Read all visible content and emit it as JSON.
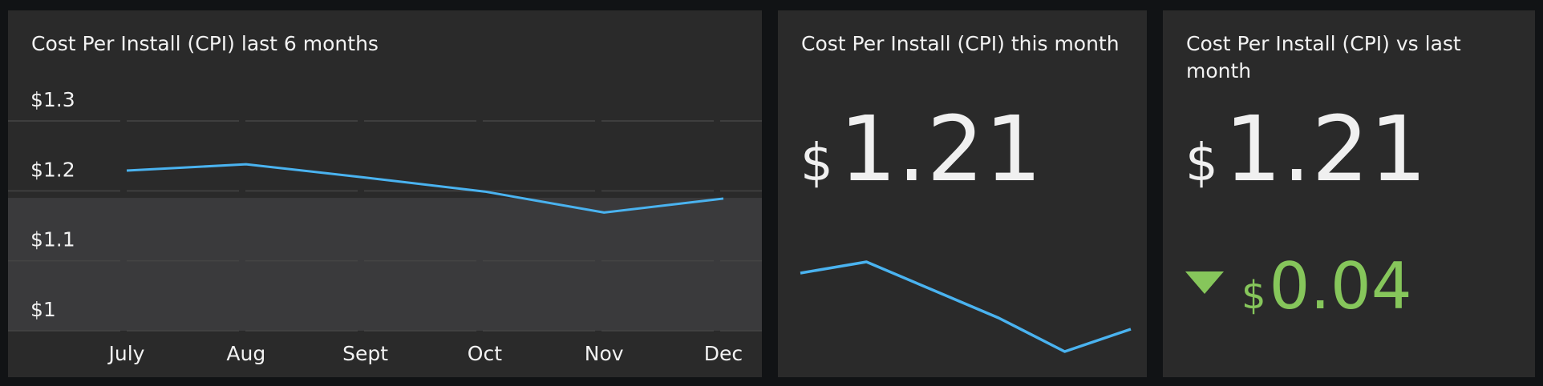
{
  "colors": {
    "background": "#111315",
    "panel": "#2a2a2a",
    "text": "#f2f2f2",
    "line": "#4ab3f0",
    "positive": "#86c65b",
    "grid": "#444444",
    "band": "#3a3a3c"
  },
  "trend_panel": {
    "title": "Cost Per Install (CPI) last 6 months"
  },
  "this_month_panel": {
    "title": "Cost Per Install (CPI) this month",
    "currency": "$",
    "value": "1.21"
  },
  "vs_last_panel": {
    "title": "Cost Per Install (CPI) vs last month",
    "currency": "$",
    "value": "1.21",
    "delta_direction": "down",
    "delta_icon": "triangle-down-icon",
    "delta_currency": "$",
    "delta_value": "0.04"
  },
  "chart_data": [
    {
      "type": "line",
      "title": "Cost Per Install (CPI) last 6 months",
      "categories": [
        "July",
        "Aug",
        "Sept",
        "Oct",
        "Nov",
        "Dec"
      ],
      "series": [
        {
          "values": [
            1.229,
            1.238,
            1.219,
            1.199,
            1.169,
            1.189
          ]
        }
      ],
      "y_ticks": [
        1.3,
        1.2,
        1.1,
        1
      ],
      "y_tick_labels": [
        "$1.3",
        "$1.2",
        "$1.1",
        "$1"
      ],
      "ylim": [
        1.0,
        1.3
      ],
      "target_band": [
        1.0,
        1.19
      ],
      "grid": true
    },
    {
      "type": "line",
      "title": "Cost Per Install (CPI) this month",
      "x": [
        1,
        2,
        3,
        4,
        5,
        6
      ],
      "series": [
        {
          "values": [
            1.22,
            1.24,
            1.19,
            1.14,
            1.08,
            1.12
          ]
        }
      ],
      "ylim": [
        1.06,
        1.26
      ],
      "grid": false,
      "axes": false
    }
  ]
}
